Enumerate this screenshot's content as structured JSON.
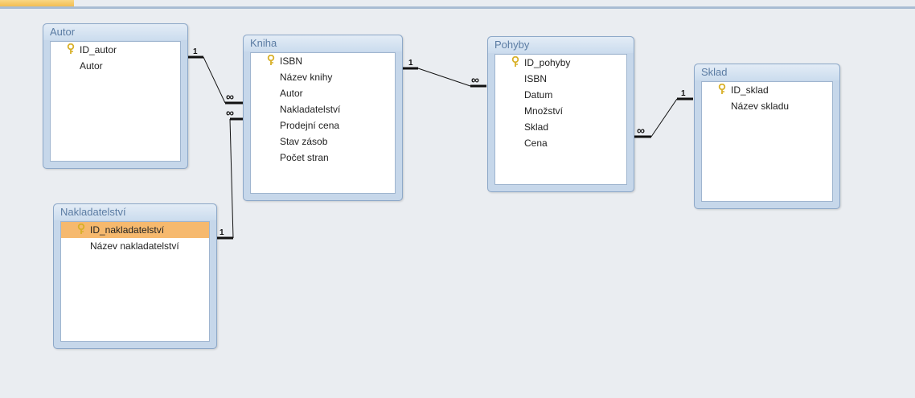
{
  "tables": {
    "autor": {
      "title": "Autor",
      "fields": [
        {
          "name": "ID_autor",
          "key": true
        },
        {
          "name": "Autor"
        }
      ]
    },
    "kniha": {
      "title": "Kniha",
      "fields": [
        {
          "name": "ISBN",
          "key": true
        },
        {
          "name": "Název knihy"
        },
        {
          "name": "Autor"
        },
        {
          "name": "Nakladatelství"
        },
        {
          "name": "Prodejní cena"
        },
        {
          "name": "Stav zásob"
        },
        {
          "name": "Počet stran"
        }
      ]
    },
    "pohyby": {
      "title": "Pohyby",
      "fields": [
        {
          "name": "ID_pohyby",
          "key": true
        },
        {
          "name": "ISBN"
        },
        {
          "name": "Datum"
        },
        {
          "name": "Množství"
        },
        {
          "name": "Sklad"
        },
        {
          "name": "Cena"
        }
      ]
    },
    "sklad": {
      "title": "Sklad",
      "fields": [
        {
          "name": "ID_sklad",
          "key": true
        },
        {
          "name": "Název skladu"
        }
      ]
    },
    "nakladatelstvi": {
      "title": "Nakladatelství",
      "fields": [
        {
          "name": "ID_nakladatelství",
          "key": true,
          "selected": true
        },
        {
          "name": "Název nakladatelství"
        }
      ]
    }
  },
  "relationships": {
    "one_label": "1",
    "many_label": "∞"
  },
  "colors": {
    "selected_field": "#f6b96e",
    "title_text": "#5b7ca3",
    "key_icon": "#d8b028"
  }
}
